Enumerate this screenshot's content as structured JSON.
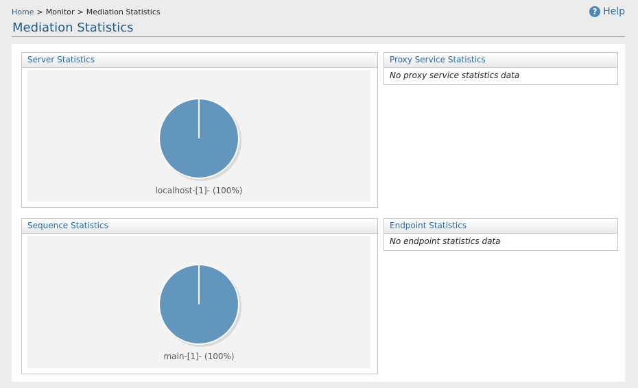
{
  "breadcrumb": {
    "home": "Home",
    "sep1": ">",
    "monitor": "Monitor",
    "sep2": ">",
    "current": "Mediation Statistics"
  },
  "help": {
    "label": "Help",
    "icon": "help-circle-icon",
    "icon_glyph": "?"
  },
  "page_title": "Mediation Statistics",
  "panels": {
    "server": {
      "title": "Server Statistics",
      "pie": {
        "slices": [
          {
            "label": "localhost-[1]- (100%)",
            "value": 1,
            "percent": 100,
            "color": "#6396bd"
          }
        ]
      }
    },
    "proxy": {
      "title": "Proxy Service Statistics",
      "message": "No proxy service statistics data"
    },
    "sequence": {
      "title": "Sequence Statistics",
      "pie": {
        "slices": [
          {
            "label": "main-[1]- (100%)",
            "value": 1,
            "percent": 100,
            "color": "#6396bd"
          }
        ]
      }
    },
    "endpoint": {
      "title": "Endpoint Statistics",
      "message": "No endpoint statistics data"
    }
  }
}
